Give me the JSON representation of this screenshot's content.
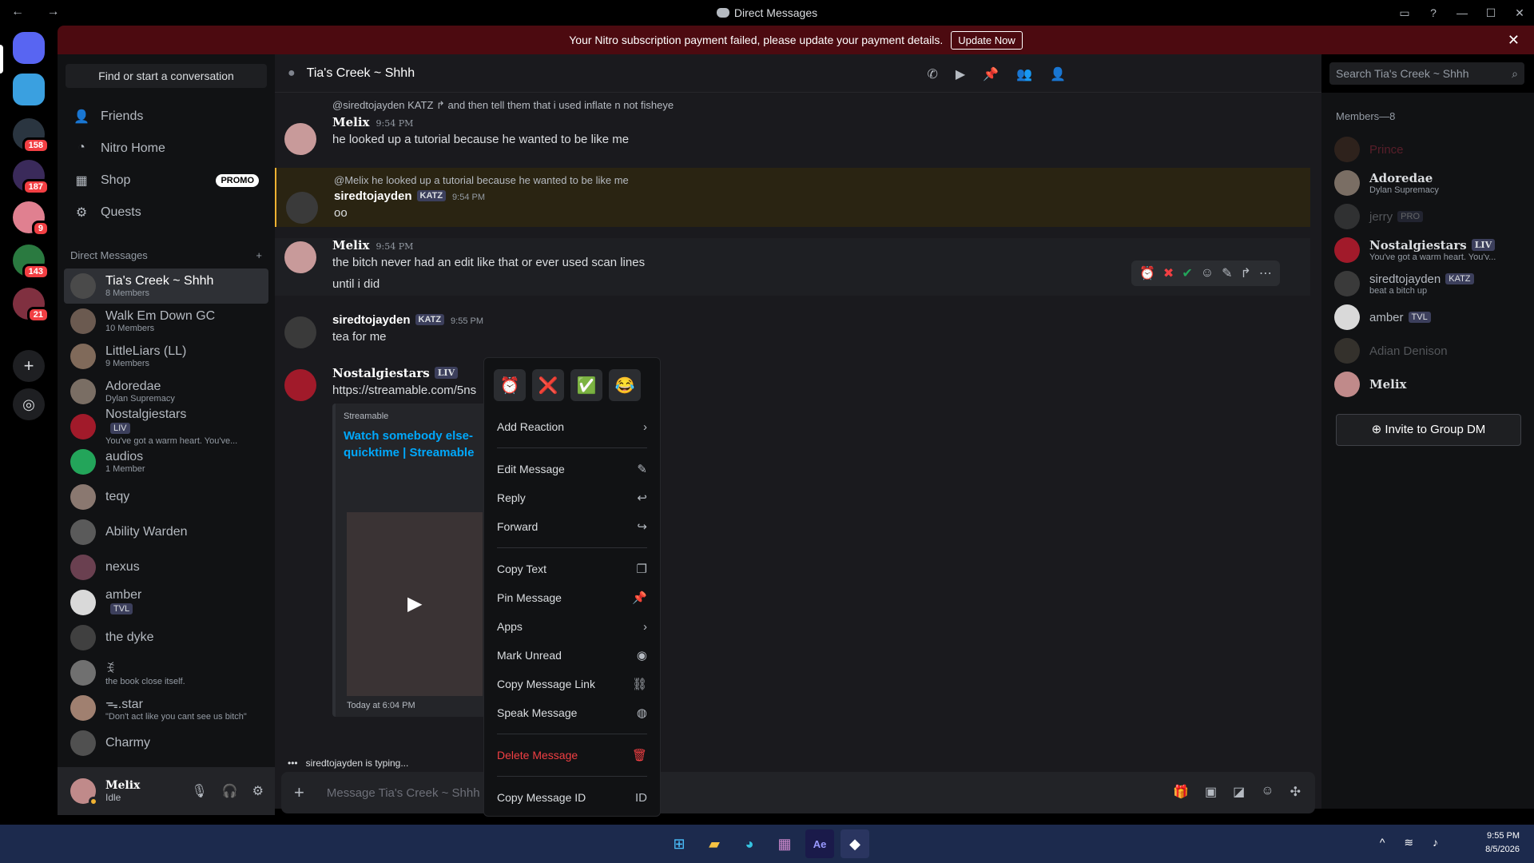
{
  "window": {
    "title": "Direct Messages"
  },
  "banner": {
    "text": "Your Nitro subscription payment failed, please update your payment details.",
    "button": "Update Now"
  },
  "guilds": {
    "badges": [
      "158",
      "187",
      "9",
      "143",
      "21"
    ]
  },
  "sidebar": {
    "find": "Find or start a conversation",
    "nav": [
      {
        "label": "Friends"
      },
      {
        "label": "Nitro Home"
      },
      {
        "label": "Shop",
        "badge": "PROMO"
      },
      {
        "label": "Quests"
      }
    ],
    "dm_header": "Direct Messages",
    "dms": [
      {
        "name": "Tia's Creek ~ Shhh",
        "sub": "8 Members",
        "color": "#4a4a4a"
      },
      {
        "name": "Walk Em Down GC",
        "sub": "10 Members",
        "color": "#6b5a50"
      },
      {
        "name": "LittleLiars (LL)",
        "sub": "9 Members",
        "color": "#806a5a"
      },
      {
        "name": "Adoredae",
        "sub": "Dylan Supremacy",
        "color": "#7a6e64"
      },
      {
        "name": "Nostalgiestars",
        "tag": "LIV",
        "sub": "You've got a warm heart. You've...",
        "color": "#a11a2a"
      },
      {
        "name": "audios",
        "sub": "1 Member",
        "color": "#23a55a"
      },
      {
        "name": "teqy",
        "sub": "",
        "color": "#8a7870"
      },
      {
        "name": "Ability Warden",
        "sub": "",
        "color": "#5a5a5a"
      },
      {
        "name": "nexus",
        "sub": "",
        "color": "#6a4050"
      },
      {
        "name": "amber",
        "tag": "TVL",
        "sub": "",
        "color": "#d9d9d9"
      },
      {
        "name": "the dyke",
        "sub": "",
        "color": "#404040"
      },
      {
        "name": "ꉂ",
        "sub": "the book close itself.",
        "color": "#707070"
      },
      {
        "name": "ᯓ.star",
        "sub": "\"Don't act like you cant see us bitch\"",
        "color": "#a08070"
      },
      {
        "name": "Charmy",
        "sub": "",
        "color": "#505050"
      }
    ]
  },
  "user": {
    "name": "Melix",
    "status": "Idle"
  },
  "chat": {
    "channel": "Tia's Creek ~ Shhh",
    "search_placeholder": "Search Tia's Creek ~ Shhh",
    "messages": [
      {
        "reply": "@siredtojayden  KATZ  ↱ and then tell them that i used inflate n not fisheye",
        "author": "Melix",
        "time": "9:54 PM",
        "text": "he looked up a tutorial because he wanted to be like me"
      },
      {
        "reply": "@Melix he looked up a tutorial because he wanted to be like me",
        "author": "siredtojayden",
        "tag": "KATZ",
        "time": "9:54 PM",
        "text": "oo"
      },
      {
        "author": "Melix",
        "time": "9:54 PM",
        "text": "the bitch never had an edit like that or ever used scan lines",
        "text2": "until i did"
      },
      {
        "author": "siredtojayden",
        "tag": "KATZ",
        "time": "9:55 PM",
        "text": "tea for me"
      },
      {
        "author": "Nostalgiestars",
        "tag": "LIV",
        "link": "https://streamable.com/5ns",
        "embed_provider": "Streamable",
        "embed_title": "Watch somebody else- quicktime | Streamable",
        "embed_footer": "Today at 6:04 PM"
      }
    ],
    "typing": "siredtojayden is typing...",
    "composer_placeholder": "Message Tia's Creek ~ Shhh"
  },
  "context_menu": {
    "emojis": [
      "⏰",
      "❌",
      "✅",
      "😂"
    ],
    "items": [
      "Add Reaction",
      "Edit Message",
      "Reply",
      "Forward",
      "Copy Text",
      "Pin Message",
      "Apps",
      "Mark Unread",
      "Copy Message Link",
      "Speak Message",
      "Delete Message",
      "Copy Message ID"
    ]
  },
  "members": {
    "header": "Members—8",
    "list": [
      {
        "name": "Prince",
        "sub": "",
        "offline": true
      },
      {
        "name": "Adoredae",
        "sub": "Dylan Supremacy"
      },
      {
        "name": "jerry",
        "tag": "PRO",
        "sub": "",
        "offline": true
      },
      {
        "name": "Nostalgiestars",
        "tag": "LIV",
        "sub": "You've got a warm heart. You'v..."
      },
      {
        "name": "siredtojayden",
        "tag": "KATZ",
        "sub": "beat a bitch up"
      },
      {
        "name": "amber",
        "tag": "TVL",
        "sub": ""
      },
      {
        "name": "Adian Denison",
        "sub": "",
        "offline": true
      },
      {
        "name": "Melix",
        "sub": ""
      }
    ],
    "invite": "Invite to Group DM"
  },
  "taskbar": {
    "time": "9:55 PM",
    "date": "8/5/2026"
  }
}
